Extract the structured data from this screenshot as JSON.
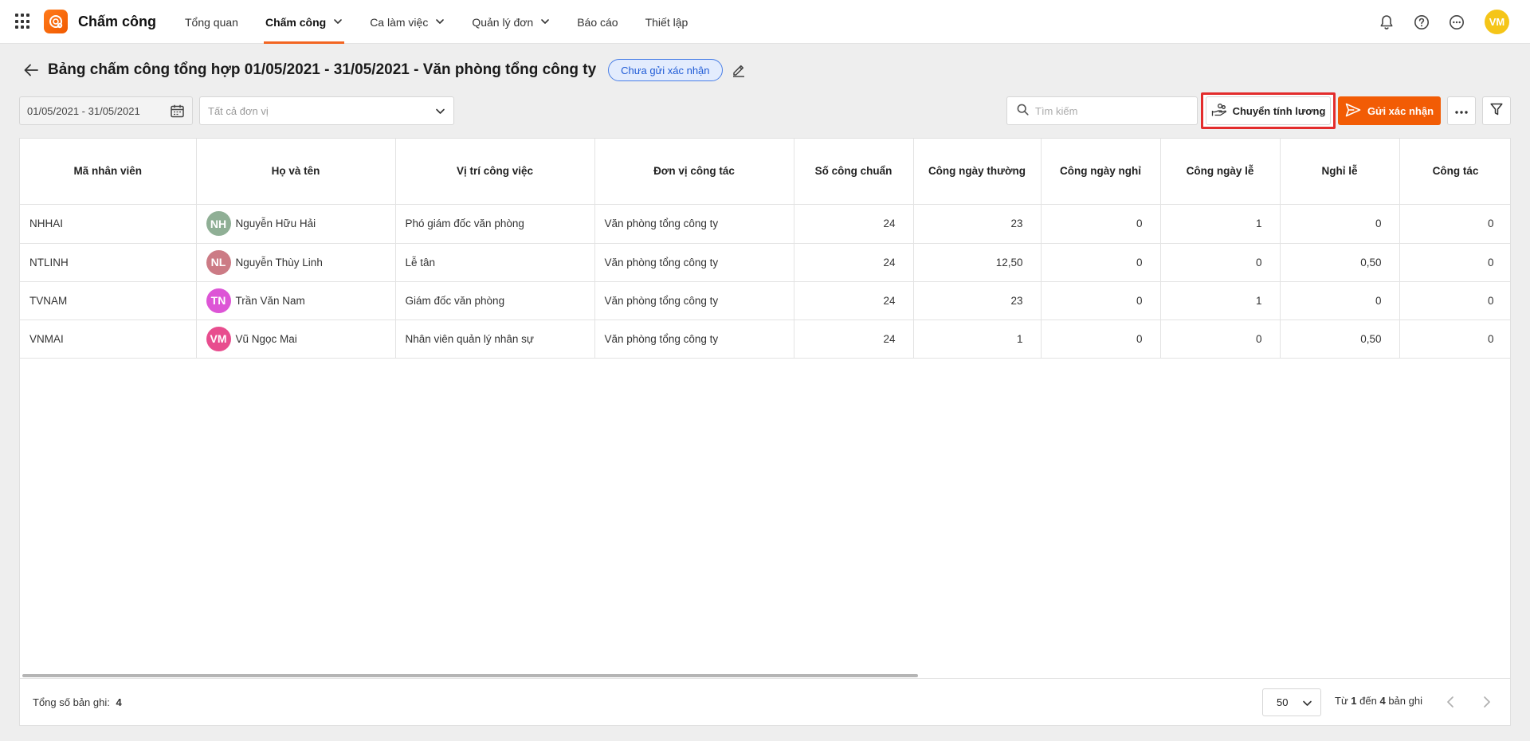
{
  "app": {
    "title": "Chấm công"
  },
  "nav": [
    {
      "label": "Tổng quan",
      "active": false,
      "dropdown": false
    },
    {
      "label": "Chấm công",
      "active": true,
      "dropdown": true
    },
    {
      "label": "Ca làm việc",
      "active": false,
      "dropdown": true
    },
    {
      "label": "Quản lý đơn",
      "active": false,
      "dropdown": true
    },
    {
      "label": "Báo cáo",
      "active": false,
      "dropdown": false
    },
    {
      "label": "Thiết lập",
      "active": false,
      "dropdown": false
    }
  ],
  "user": {
    "initials": "VM",
    "avatar_color": "#f5c518"
  },
  "page": {
    "title": "Bảng chấm công tổng hợp 01/05/2021 - 31/05/2021 - Văn phòng tổng công ty",
    "status_badge": "Chưa gửi xác nhận"
  },
  "filters": {
    "date_range": "01/05/2021 - 31/05/2021",
    "unit_placeholder": "Tất cả đơn vị",
    "search_placeholder": "Tìm kiếm"
  },
  "actions": {
    "payroll_label": "Chuyển tính lương",
    "send_label": "Gửi xác nhận",
    "accent_color": "#f25c05"
  },
  "table": {
    "columns": [
      "Mã nhân viên",
      "Họ và tên",
      "Vị trí công việc",
      "Đơn vị công tác",
      "Số công chuẩn",
      "Công ngày thường",
      "Công ngày nghỉ",
      "Công ngày lễ",
      "Nghỉ lễ",
      "Công tác"
    ],
    "rows": [
      {
        "code": "NHHAI",
        "initials": "NH",
        "avatar_color": "#8faf95",
        "name": "Nguyễn Hữu Hải",
        "position": "Phó giám đốc văn phòng",
        "unit": "Văn phòng tổng công ty",
        "standard": "24",
        "normal": "23",
        "weekend": "0",
        "holiday_work": "1",
        "holiday_off": "0",
        "business": "0"
      },
      {
        "code": "NTLINH",
        "initials": "NL",
        "avatar_color": "#cc7b85",
        "name": "Nguyễn Thùy Linh",
        "position": "Lễ tân",
        "unit": "Văn phòng tổng công ty",
        "standard": "24",
        "normal": "12,50",
        "weekend": "0",
        "holiday_work": "0",
        "holiday_off": "0,50",
        "business": "0"
      },
      {
        "code": "TVNAM",
        "initials": "TN",
        "avatar_color": "#dd55d6",
        "name": "Trần Văn Nam",
        "position": "Giám đốc văn phòng",
        "unit": "Văn phòng tổng công ty",
        "standard": "24",
        "normal": "23",
        "weekend": "0",
        "holiday_work": "1",
        "holiday_off": "0",
        "business": "0"
      },
      {
        "code": "VNMAI",
        "initials": "VM",
        "avatar_color": "#e84d8e",
        "name": "Vũ Ngọc Mai",
        "position": "Nhân viên quản lý nhân sự",
        "unit": "Văn phòng tổng công ty",
        "standard": "24",
        "normal": "1",
        "weekend": "0",
        "holiday_work": "0",
        "holiday_off": "0,50",
        "business": "0"
      }
    ]
  },
  "footer": {
    "total_label": "Tổng số bản ghi:",
    "total_value": "4",
    "page_size": "50",
    "range_prefix": "Từ",
    "range_from": "1",
    "range_mid": "đến",
    "range_to": "4",
    "range_suffix": "bản ghi"
  }
}
